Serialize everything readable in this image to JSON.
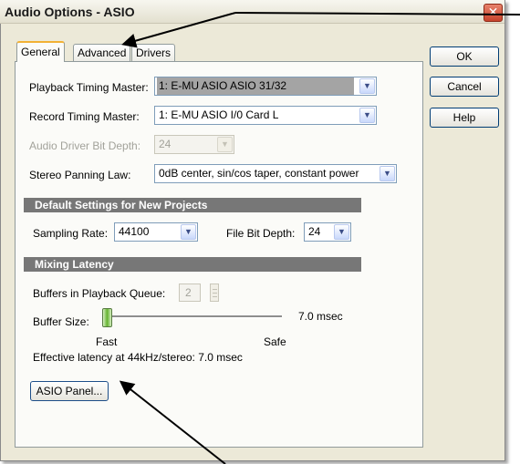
{
  "window": {
    "title": "Audio Options - ASIO",
    "close_glyph": "✕"
  },
  "tabs": [
    {
      "label": "General",
      "active": true
    },
    {
      "label": "Advanced",
      "active": false
    },
    {
      "label": "Drivers",
      "active": false
    }
  ],
  "buttons": {
    "ok": "OK",
    "cancel": "Cancel",
    "help": "Help",
    "asio_panel": "ASIO Panel..."
  },
  "general": {
    "playback_timing_master": {
      "label": "Playback Timing Master:",
      "value": "1: E-MU ASIO ASIO 31/32"
    },
    "record_timing_master": {
      "label": "Record Timing Master:",
      "value": "1: E-MU ASIO I/0 Card L"
    },
    "audio_driver_bit_depth": {
      "label": "Audio Driver Bit Depth:",
      "value": "24"
    },
    "stereo_panning_law": {
      "label": "Stereo Panning Law:",
      "value": "0dB center, sin/cos taper, constant power"
    }
  },
  "default_settings": {
    "header": "Default Settings for New Projects",
    "sampling_rate": {
      "label": "Sampling Rate:",
      "value": "44100"
    },
    "file_bit_depth": {
      "label": "File Bit Depth:",
      "value": "24"
    }
  },
  "mixing_latency": {
    "header": "Mixing Latency",
    "buffers_label": "Buffers in Playback Queue:",
    "buffers_value": "2",
    "buffer_size_label": "Buffer Size:",
    "buffer_size_value": "7.0 msec",
    "slider_position": 0.0,
    "fast_label": "Fast",
    "safe_label": "Safe",
    "effective_latency": "Effective latency at 44kHz/stereo:  7.0 msec"
  },
  "icons": {
    "dropdown": "chevron-down-icon",
    "close": "close-icon"
  },
  "colors": {
    "panel_bg": "#ece9d8",
    "section_header_bg": "#777777",
    "arrow": "#000000"
  }
}
